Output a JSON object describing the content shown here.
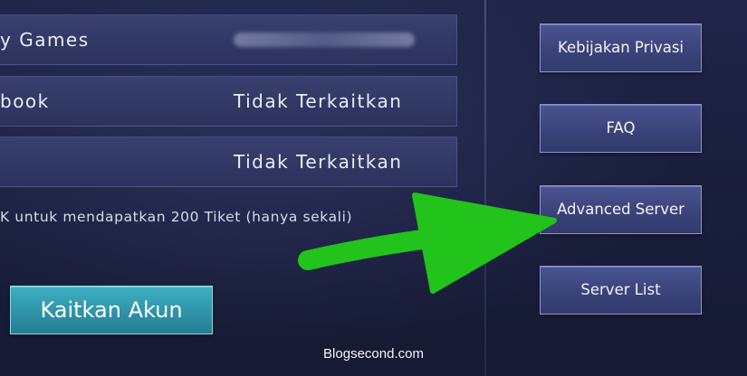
{
  "accounts": [
    {
      "label": "y Games",
      "value": ""
    },
    {
      "label": "book",
      "value": "Tidak Terkaitkan"
    },
    {
      "label": "",
      "value": "Tidak Terkaitkan"
    }
  ],
  "reward_text": "K untuk mendapatkan 200 Tiket (hanya sekali)",
  "link_button": "Kaitkan Akun",
  "side_buttons": {
    "privacy": "Kebijakan Privasi",
    "faq": "FAQ",
    "advanced_server": "Advanced Server",
    "server_list": "Server List"
  },
  "watermark": "Blogsecond.com",
  "colors": {
    "arrow": "#22c31a",
    "link_button": "#3fb0c2",
    "side_button": "#3a4379"
  }
}
